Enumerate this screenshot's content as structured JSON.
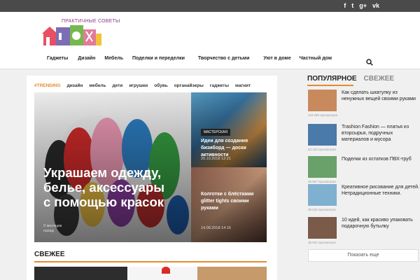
{
  "social": [
    "f",
    "t",
    "g+",
    "vk"
  ],
  "logo": {
    "text": "ПРАКТИЧНЫЕ СОВЕТЫ"
  },
  "nav": [
    "Гаджеты",
    "Дизайн",
    "Мебель",
    "Поделки и переделки",
    "Творчество с детьми",
    "Уют в доме",
    "Частный дом"
  ],
  "trending": [
    "#TRENDING",
    "дизайн",
    "мебель",
    "дети",
    "игрушки",
    "обувь",
    "органайзеры",
    "гаджеты",
    "магнит"
  ],
  "featured": {
    "big": {
      "title": "Украшаем одежду, белье, аксессуары с помощью красок",
      "date": "9 месяцев назад"
    },
    "small1": {
      "badge": "МАСТЕРСКАЯ",
      "title": "Идеи для создания бизиборд — доски активности",
      "date": "20.10.2018 12:21"
    },
    "small2": {
      "title": "Колготки с блёстками glitter tights своими руками",
      "date": "14.08.2018 14:15"
    }
  },
  "fresh": {
    "heading": "СВЕЖЕЕ"
  },
  "sidebar": {
    "tabs": [
      "ПОПУЛЯРНОЕ",
      "СВЕЖЕЕ"
    ],
    "items": [
      {
        "title": "Как сделать шкатулку из ненужных вещей своими руками",
        "meta": "115 280 просмотров",
        "color": "#c88a5c"
      },
      {
        "title": "Trashion Fashion — платья из вторсырья, подручных материалов и мусора",
        "meta": "63 134 просмотров",
        "color": "#4a7aa8"
      },
      {
        "title": "Поделки из остатков ПВХ-труб",
        "meta": "45 667 просмотров",
        "color": "#6aa06a"
      },
      {
        "title": "Креативное рисование для детей. Нетрадиционные техники.",
        "meta": "39 632 просмотров",
        "color": "#7fb0d0"
      },
      {
        "title": "10 идей, как красиво упаковать подарочную бутылку",
        "meta": "36 001 просмотров",
        "color": "#7a5a48"
      }
    ],
    "more_button": "Показать еще"
  },
  "colors": {
    "accent": "#e58a2e",
    "topbar": "#4a4a4a"
  }
}
